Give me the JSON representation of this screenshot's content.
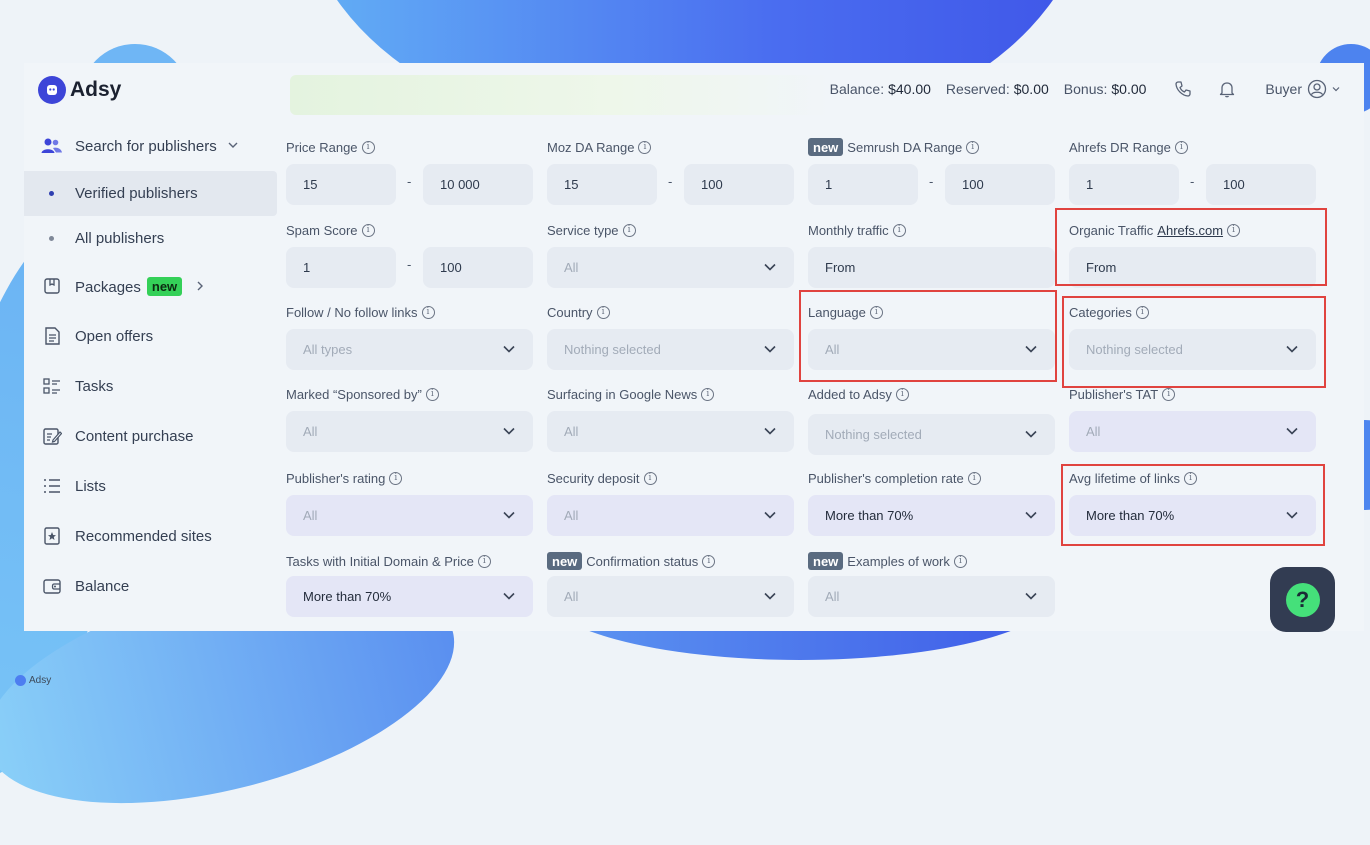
{
  "brand": {
    "name": "Adsy",
    "watermark": "Adsy"
  },
  "header": {
    "balance_label": "Balance:",
    "balance_value": "$40.00",
    "reserved_label": "Reserved:",
    "reserved_value": "$0.00",
    "bonus_label": "Bonus:",
    "bonus_value": "$0.00",
    "user_label": "Buyer"
  },
  "sidebar": {
    "search": "Search for publishers",
    "verified": "Verified publishers",
    "all": "All publishers",
    "packages": "Packages",
    "packages_badge": "new",
    "open_offers": "Open offers",
    "tasks": "Tasks",
    "content_purchase": "Content purchase",
    "lists": "Lists",
    "recommended": "Recommended sites",
    "balance": "Balance"
  },
  "filters": {
    "new_badge": "new",
    "price": {
      "label": "Price Range",
      "from": "15",
      "to": "10 000"
    },
    "moz": {
      "label": "Moz DA Range",
      "from": "15",
      "to": "100"
    },
    "semrush": {
      "label": "Semrush DA Range",
      "from": "1",
      "to": "100"
    },
    "ahrefs": {
      "label": "Ahrefs DR Range",
      "from": "1",
      "to": "100"
    },
    "spam": {
      "label": "Spam Score",
      "from": "1",
      "to": "100"
    },
    "service": {
      "label": "Service type",
      "value": "All"
    },
    "monthly": {
      "label": "Monthly traffic",
      "value": "From"
    },
    "organic": {
      "label": "Organic Traffic",
      "link": "Ahrefs.com",
      "value": "From"
    },
    "follow": {
      "label": "Follow / No follow links",
      "value": "All types"
    },
    "country": {
      "label": "Country",
      "value": "Nothing selected"
    },
    "language": {
      "label": "Language",
      "value": "All"
    },
    "categories": {
      "label": "Categories",
      "value": "Nothing selected"
    },
    "sponsored": {
      "label": "Marked “Sponsored by”",
      "value": "All"
    },
    "gnews": {
      "label": "Surfacing in Google News",
      "value": "All"
    },
    "added": {
      "label": "Added to Adsy",
      "value": "Nothing selected"
    },
    "tat": {
      "label": "Publisher's TAT",
      "value": "All"
    },
    "rating": {
      "label": "Publisher's rating",
      "value": "All"
    },
    "deposit": {
      "label": "Security deposit",
      "value": "All"
    },
    "completion": {
      "label": "Publisher's completion rate",
      "value": "More than 70%"
    },
    "lifetime": {
      "label": "Avg lifetime of links",
      "value": "More than 70%"
    },
    "tasks_initial": {
      "label": "Tasks with Initial Domain & Price",
      "value": "More than 70%"
    },
    "confirmation": {
      "label": "Confirmation status",
      "value": "All"
    },
    "examples": {
      "label": "Examples of work",
      "value": "All"
    }
  },
  "colors": {
    "accent": "#3d45d8",
    "highlight": "#e0433f",
    "badge_green": "#34d058"
  }
}
